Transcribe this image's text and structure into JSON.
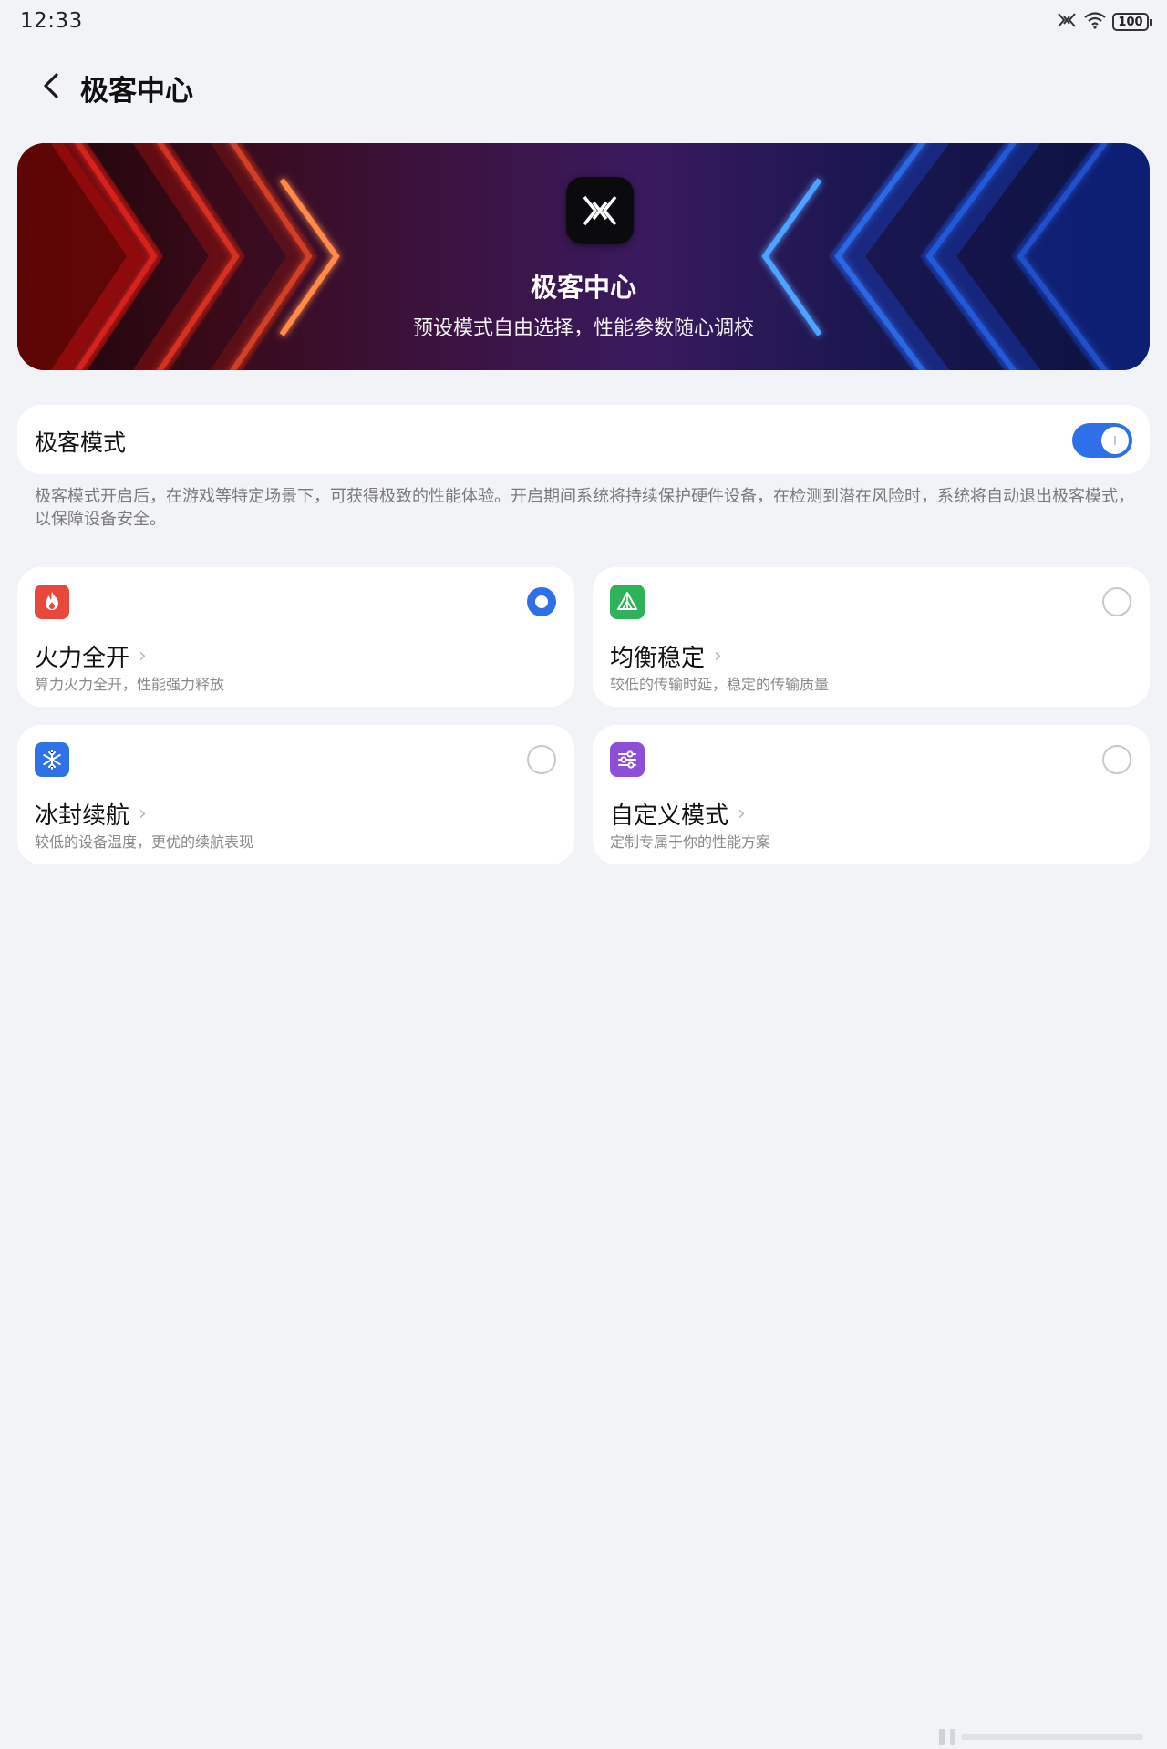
{
  "status": {
    "time": "12:33",
    "battery": "100"
  },
  "header": {
    "title": "极客中心"
  },
  "banner": {
    "title": "极客中心",
    "subtitle": "预设模式自由选择，性能参数随心调校"
  },
  "geek_mode": {
    "label": "极客模式",
    "enabled": true,
    "description": "极客模式开启后，在游戏等特定场景下，可获得极致的性能体验。开启期间系统将持续保护硬件设备，在检测到潜在风险时，系统将自动退出极客模式，以保障设备安全。"
  },
  "options": [
    {
      "title": "火力全开",
      "subtitle": "算力火力全开，性能强力释放",
      "icon": "flame-icon",
      "color": "#e8483c",
      "selected": true
    },
    {
      "title": "均衡稳定",
      "subtitle": "较低的传输时延，稳定的传输质量",
      "icon": "pyramid-icon",
      "color": "#2fb35a",
      "selected": false
    },
    {
      "title": "冰封续航",
      "subtitle": "较低的设备温度，更优的续航表现",
      "icon": "snowflake-icon",
      "color": "#2f72e6",
      "selected": false
    },
    {
      "title": "自定义模式",
      "subtitle": "定制专属于你的性能方案",
      "icon": "sliders-icon",
      "color": "#8e4fd8",
      "selected": false
    }
  ],
  "colors": {
    "accent": "#2f6fe8",
    "background": "#f1f3f6"
  }
}
